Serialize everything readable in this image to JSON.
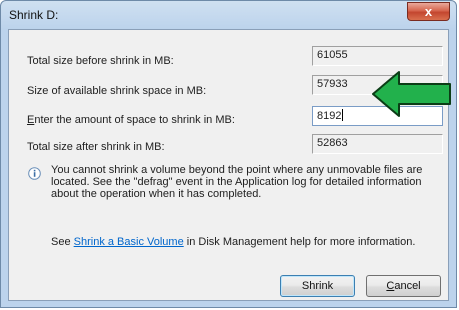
{
  "window": {
    "title": "Shrink D:",
    "close_label": "x"
  },
  "rows": [
    {
      "label": "Total size before shrink in MB:",
      "value": "61055"
    },
    {
      "label": "Size of available shrink space in MB:",
      "value": "57933"
    },
    {
      "label_mnemonic": "E",
      "label_rest": "nter the amount of space to shrink in MB:",
      "value": "8192"
    },
    {
      "label": "Total size after shrink in MB:",
      "value": "52863"
    }
  ],
  "info": {
    "text": "You cannot shrink a volume beyond the point where any unmovable files are located. See the \"defrag\" event in the Application log for detailed information about the operation when it has completed."
  },
  "help": {
    "prefix": "See ",
    "link": "Shrink a Basic Volume",
    "suffix": " in Disk Management help for more information."
  },
  "buttons": {
    "shrink": "Shrink",
    "cancel_mnemonic": "C",
    "cancel_rest": "ancel"
  },
  "colors": {
    "arrow": "#22b14c",
    "link": "#0066cc"
  }
}
